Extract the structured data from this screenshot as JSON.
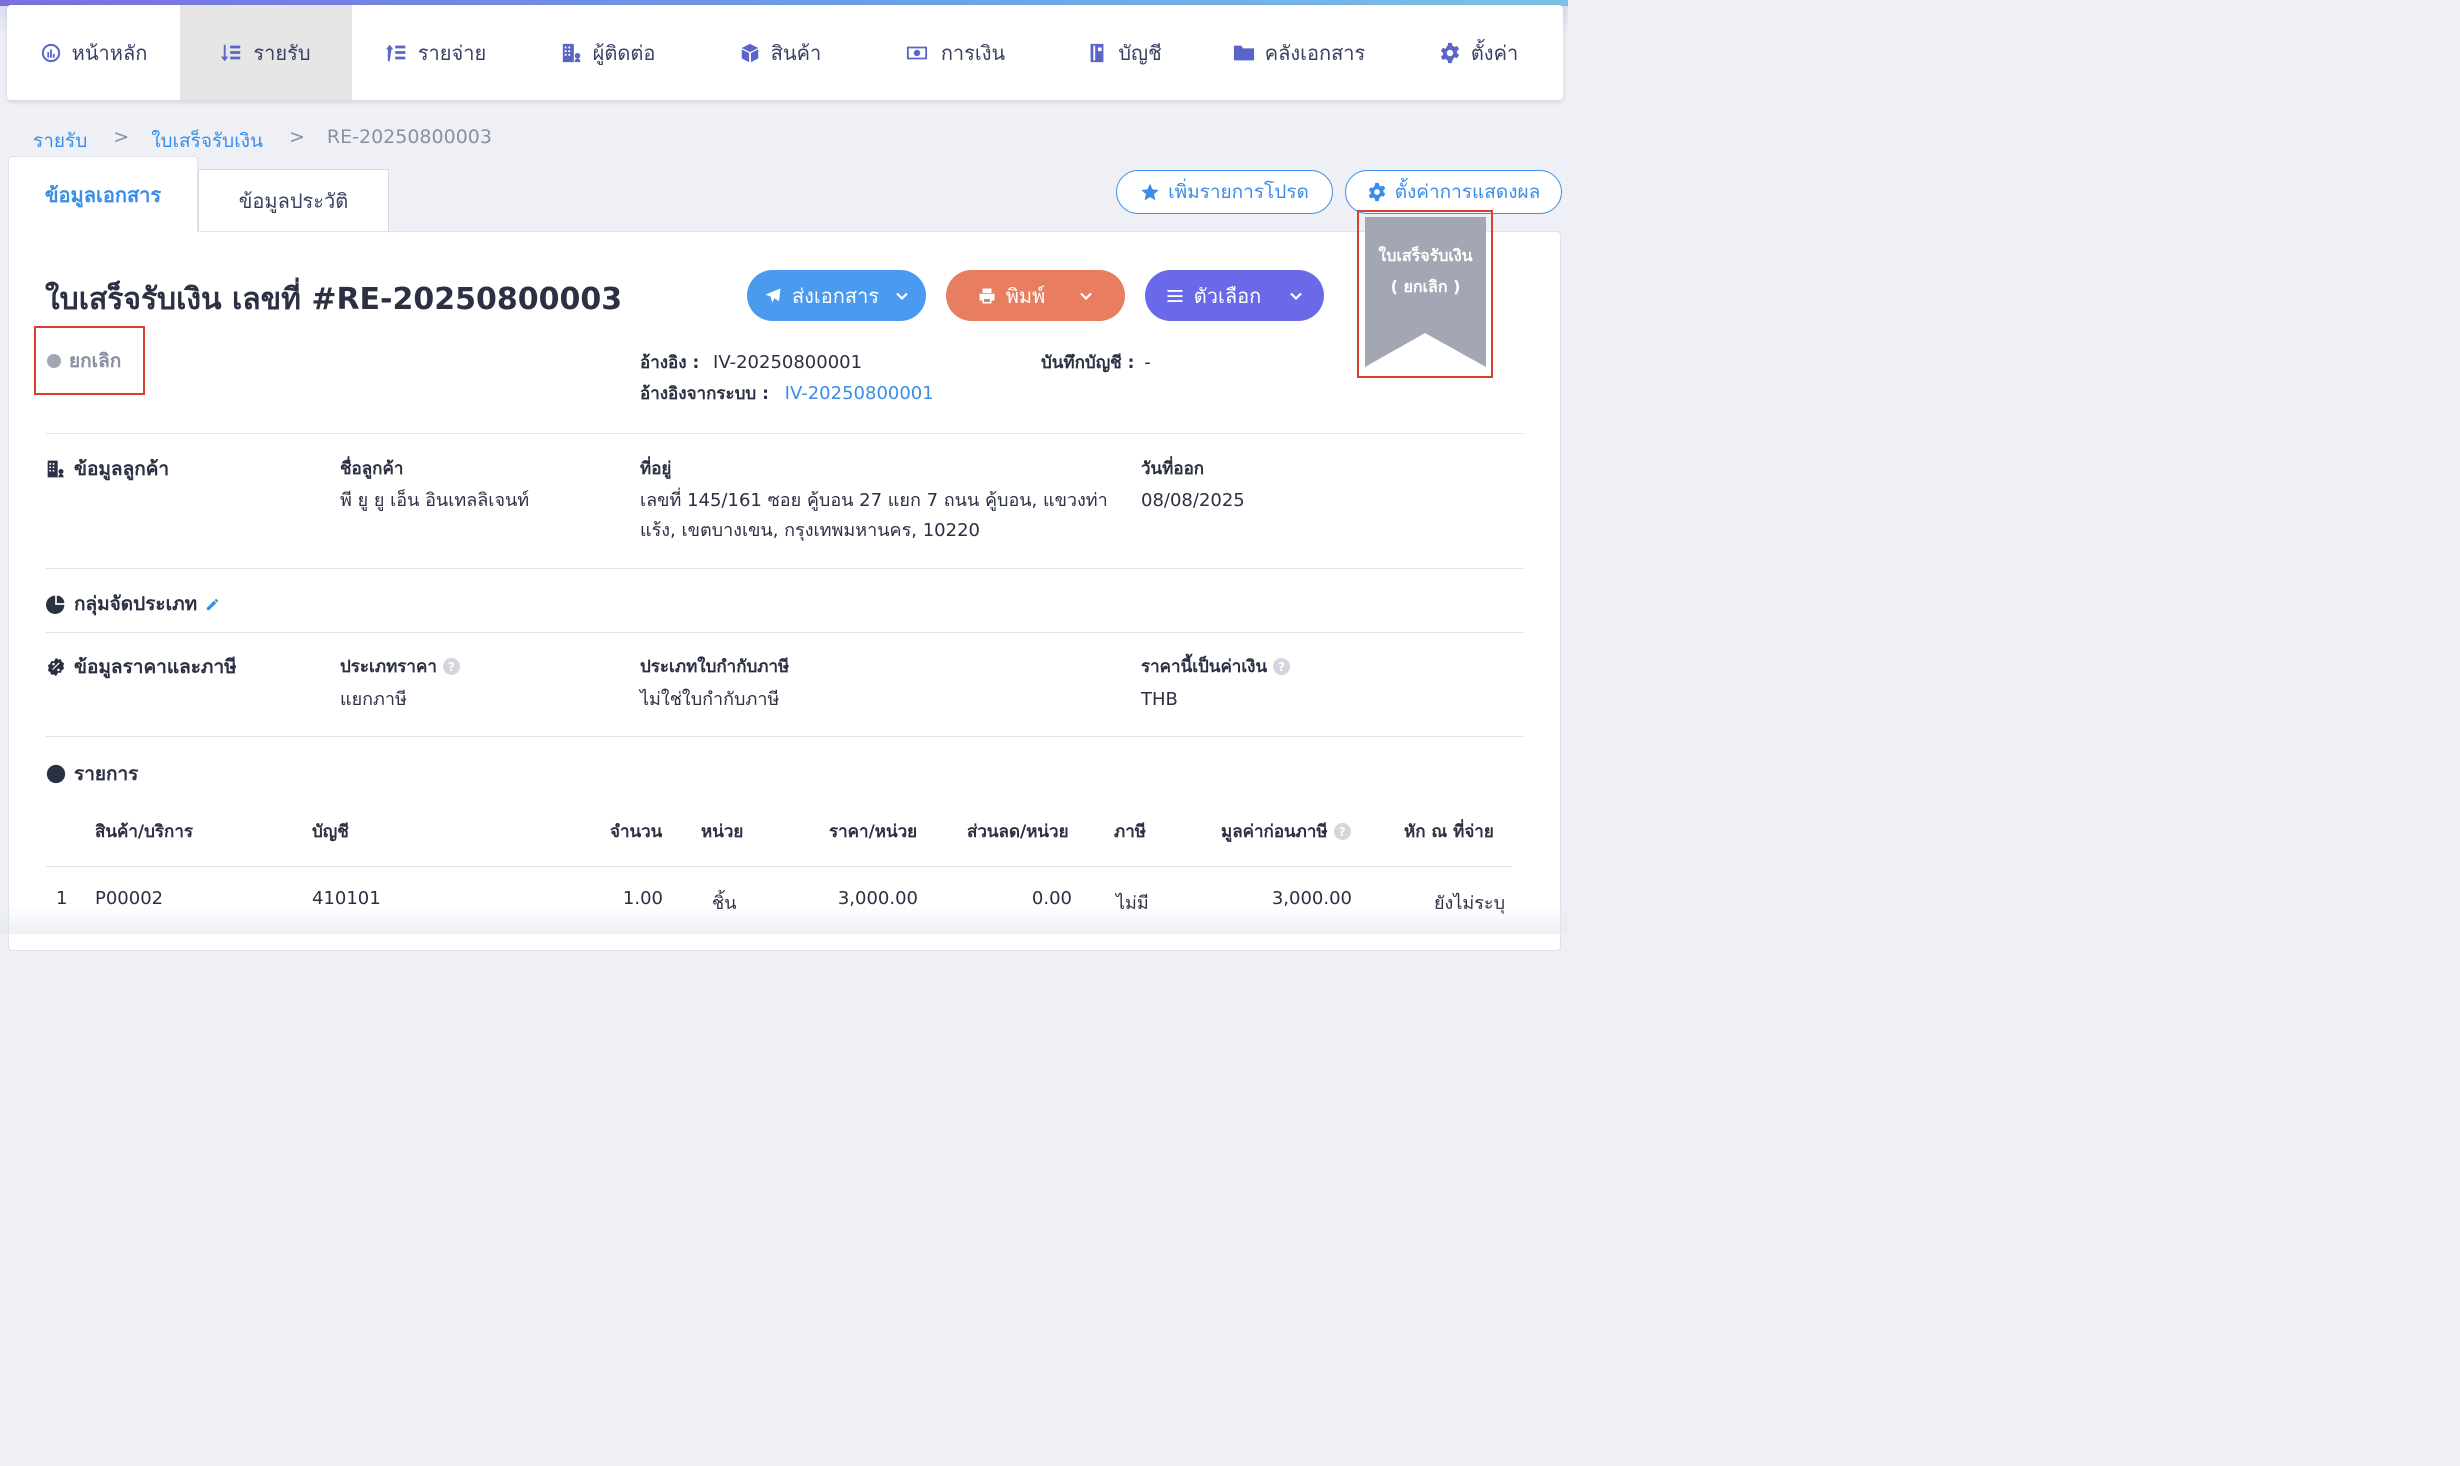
{
  "nav": [
    {
      "label": "หน้าหลัก",
      "icon": "dashboard-icon"
    },
    {
      "label": "รายรับ",
      "icon": "income-icon",
      "active": true
    },
    {
      "label": "รายจ่าย",
      "icon": "expense-icon"
    },
    {
      "label": "ผู้ติดต่อ",
      "icon": "contacts-icon"
    },
    {
      "label": "สินค้า",
      "icon": "product-box-icon"
    },
    {
      "label": "การเงิน",
      "icon": "money-icon"
    },
    {
      "label": "บัญชี",
      "icon": "account-book-icon"
    },
    {
      "label": "คลังเอกสาร",
      "icon": "folder-icon"
    },
    {
      "label": "ตั้งค่า",
      "icon": "gear-icon"
    }
  ],
  "breadcrumb": {
    "level1": "รายรับ",
    "level2": "ใบเสร็จรับเงิน",
    "current": "RE-20250800003",
    "sep": ">"
  },
  "tabs": {
    "doc_info": "ข้อมูลเอกสาร",
    "history": "ข้อมูลประวัติ"
  },
  "top_buttons": {
    "favorite": "เพิ่มรายการโปรด",
    "display_settings": "ตั้งค่าการแสดงผล"
  },
  "document": {
    "title": "ใบเสร็จรับเงิน เลขที่ #RE-20250800003",
    "status": "ยกเลิก",
    "ribbon_line1": "ใบเสร็จรับเงิน",
    "ribbon_line2": "( ยกเลิก )"
  },
  "actions": {
    "send": "ส่งเอกสาร",
    "print": "พิมพ์",
    "options": "ตัวเลือก"
  },
  "colors": {
    "send": "#4a9af0",
    "print": "#e87e5f",
    "options": "#6a6ae8",
    "link": "#3a8de8",
    "ribbon": "#a3a6b3",
    "highlight": "#d8412f"
  },
  "refs": {
    "ref_label": "อ้างอิง :",
    "ref_value": "IV-20250800001",
    "sys_ref_label": "อ้างอิงจากระบบ :",
    "sys_ref_value": "IV-20250800001",
    "journal_label": "บันทึกบัญชี :",
    "journal_value": "-"
  },
  "customer": {
    "section": "ข้อมูลลูกค้า",
    "name_label": "ชื่อลูกค้า",
    "name": "พี ยู ยู เอ็น อินเทลลิเจนท์",
    "address_label": "ที่อยู่",
    "address_line1": "เลขที่ 145/161 ซอย คู้บอน 27 แยก 7 ถนน คู้บอน, แขวงท่า",
    "address_line2": "แร้ง, เขตบางเขน, กรุงเทพมหานคร, 10220",
    "date_label": "วันที่ออก",
    "date": "08/08/2025"
  },
  "category": {
    "section": "กลุ่มจัดประเภท"
  },
  "pricing": {
    "section": "ข้อมูลราคาและภาษี",
    "price_type_label": "ประเภทราคา",
    "price_type": "แยกภาษี",
    "tax_invoice_label": "ประเภทใบกำกับภาษี",
    "tax_invoice": "ไม่ใช่ใบกำกับภาษี",
    "currency_label": "ราคานี้เป็นค่าเงิน",
    "currency": "THB"
  },
  "items": {
    "section": "รายการ",
    "headers": [
      "สินค้า/บริการ",
      "บัญชี",
      "จำนวน",
      "หน่วย",
      "ราคา/หน่วย",
      "ส่วนลด/หน่วย",
      "ภาษี",
      "มูลค่าก่อนภาษี",
      "หัก ณ ที่จ่าย"
    ],
    "rows": [
      {
        "no": "1",
        "product": "P00002",
        "account": "410101",
        "qty": "1.00",
        "unit": "ชิ้น",
        "price": "3,000.00",
        "discount": "0.00",
        "tax": "ไม่มี",
        "pretax": "3,000.00",
        "wht": "ยังไม่ระบุ"
      }
    ]
  }
}
